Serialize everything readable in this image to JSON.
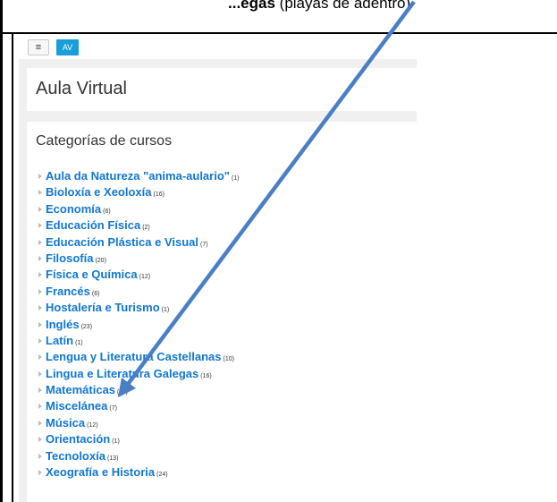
{
  "header": {
    "bold_text": "...egas",
    "rest_text": "(playas de adentro)"
  },
  "topbar": {
    "menu_icon": "hamburger-icon",
    "av_label": "AV"
  },
  "page_title": "Aula Virtual",
  "categories": {
    "heading": "Categorías de cursos",
    "items": [
      {
        "name": "Aula da Natureza \"anima-aulario\"",
        "count": "(1)"
      },
      {
        "name": "Bioloxía e Xeoloxía",
        "count": "(16)"
      },
      {
        "name": "Economía",
        "count": "(6)"
      },
      {
        "name": "Educación Física",
        "count": "(2)"
      },
      {
        "name": "Educación Plástica e Visual",
        "count": "(7)"
      },
      {
        "name": "Filosofía",
        "count": "(20)"
      },
      {
        "name": "Física e Química",
        "count": "(12)"
      },
      {
        "name": "Francés",
        "count": "(6)"
      },
      {
        "name": "Hostalería e Turismo",
        "count": "(1)"
      },
      {
        "name": "Inglés",
        "count": "(23)"
      },
      {
        "name": "Latín",
        "count": "(1)"
      },
      {
        "name": "Lengua y Literatura Castellanas",
        "count": "(10)"
      },
      {
        "name": "Lingua e Literatura Galegas",
        "count": "(16)"
      },
      {
        "name": "Matemáticas",
        "count": "(11)"
      },
      {
        "name": "Miscelánea",
        "count": "(7)"
      },
      {
        "name": "Música",
        "count": "(12)"
      },
      {
        "name": "Orientación",
        "count": "(1)"
      },
      {
        "name": "Tecnoloxía",
        "count": "(13)"
      },
      {
        "name": "Xeografía e Historia",
        "count": "(24)"
      }
    ]
  },
  "colors": {
    "link": "#1177d1",
    "av_button": "#1a9ed9",
    "arrow": "#4a7fc4",
    "panel_bg": "#f0f0f0"
  },
  "annotation": {
    "icon": "arrow-annotation-icon"
  }
}
